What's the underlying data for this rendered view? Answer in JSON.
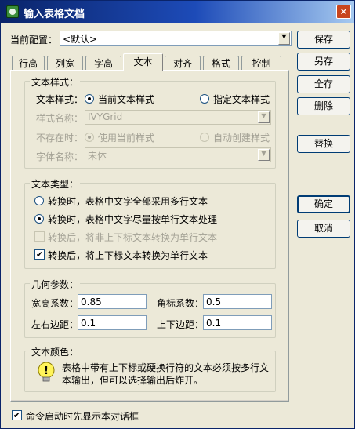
{
  "window": {
    "title": "输入表格文档",
    "close_glyph": "✕"
  },
  "config": {
    "label": "当前配置：",
    "value": "<默认>"
  },
  "tabs": [
    {
      "label": "行高"
    },
    {
      "label": "列宽"
    },
    {
      "label": "字高"
    },
    {
      "label": "文本",
      "active": true
    },
    {
      "label": "对齐"
    },
    {
      "label": "格式"
    },
    {
      "label": "控制"
    }
  ],
  "text_style": {
    "title": "文本样式：",
    "row_label": "文本样式：",
    "option_current": "当前文本样式",
    "option_specified": "指定文本样式",
    "style_name_label": "样式名称：",
    "style_name_value": "IVYGrid",
    "missing_label": "不存在时：",
    "missing_use_current": "使用当前样式",
    "missing_auto_create": "自动创建样式",
    "font_name_label": "字体名称：",
    "font_name_value": "宋体"
  },
  "text_type": {
    "title": "文本类型：",
    "option_multi": "转换时，表格中文字全部采用多行文本",
    "option_single_first": "转换时，表格中文字尽量按单行文本处理",
    "check_non_sub": "转换后，将非上下标文本转换为单行文本",
    "check_sub": "转换后，将上下标文本转换为单行文本"
  },
  "geometry": {
    "title": "几何参数：",
    "aspect_label": "宽高系数：",
    "aspect_value": "0.85",
    "corner_label": "角标系数：",
    "corner_value": "0.5",
    "lr_margin_label": "左右边距：",
    "lr_margin_value": "0.1",
    "tb_margin_label": "上下边距：",
    "tb_margin_value": "0.1"
  },
  "text_color": {
    "title": "文本颜色：",
    "note_line1": "表格中带有上下标或硬换行符的文本必须按多行文",
    "note_line2": "本输出，但可以选择输出后炸开。"
  },
  "buttons": {
    "save": "保存",
    "save_as": "另存",
    "save_all": "全存",
    "delete": "删除",
    "replace": "替换",
    "ok": "确定",
    "cancel": "取消"
  },
  "footer": {
    "show_dialog_check": "命令启动时先显示本对话框"
  },
  "colors": {
    "title_bar_start": "#0a246a",
    "title_bar_end": "#a6caf0",
    "dialog_bg": "#ece9d8",
    "close_button": "#c8451c"
  }
}
